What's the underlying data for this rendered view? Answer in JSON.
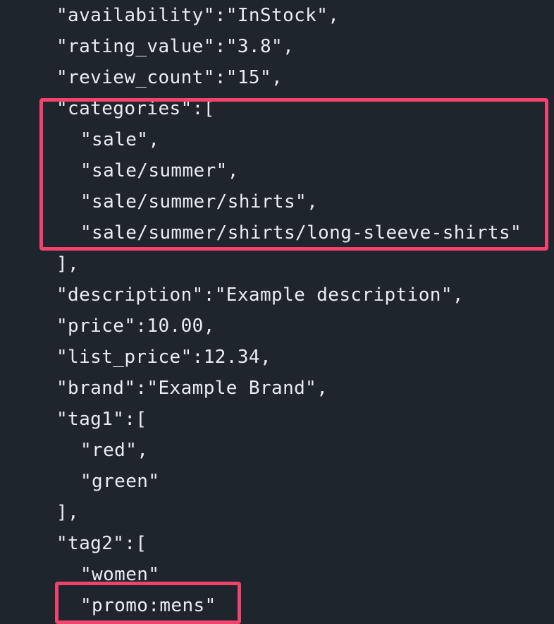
{
  "code": {
    "lines": [
      "\"availability\":\"InStock\",",
      "\"rating_value\":\"3.8\",",
      "\"review_count\":\"15\",",
      "\"categories\":[",
      "\"sale\",",
      "\"sale/summer\",",
      "\"sale/summer/shirts\",",
      "\"sale/summer/shirts/long-sleeve-shirts\"",
      "],",
      "\"description\":\"Example description\",",
      "\"price\":10.00,",
      "\"list_price\":12.34,",
      "\"brand\":\"Example Brand\",",
      "\"tag1\":[",
      "\"red\",",
      "\"green\"",
      "],",
      "\"tag2\":[",
      "\"women\"",
      "\"promo:mens\""
    ]
  },
  "colors": {
    "background": "#1f252d",
    "text": "#e9edf1",
    "highlight": "#f2426e"
  }
}
